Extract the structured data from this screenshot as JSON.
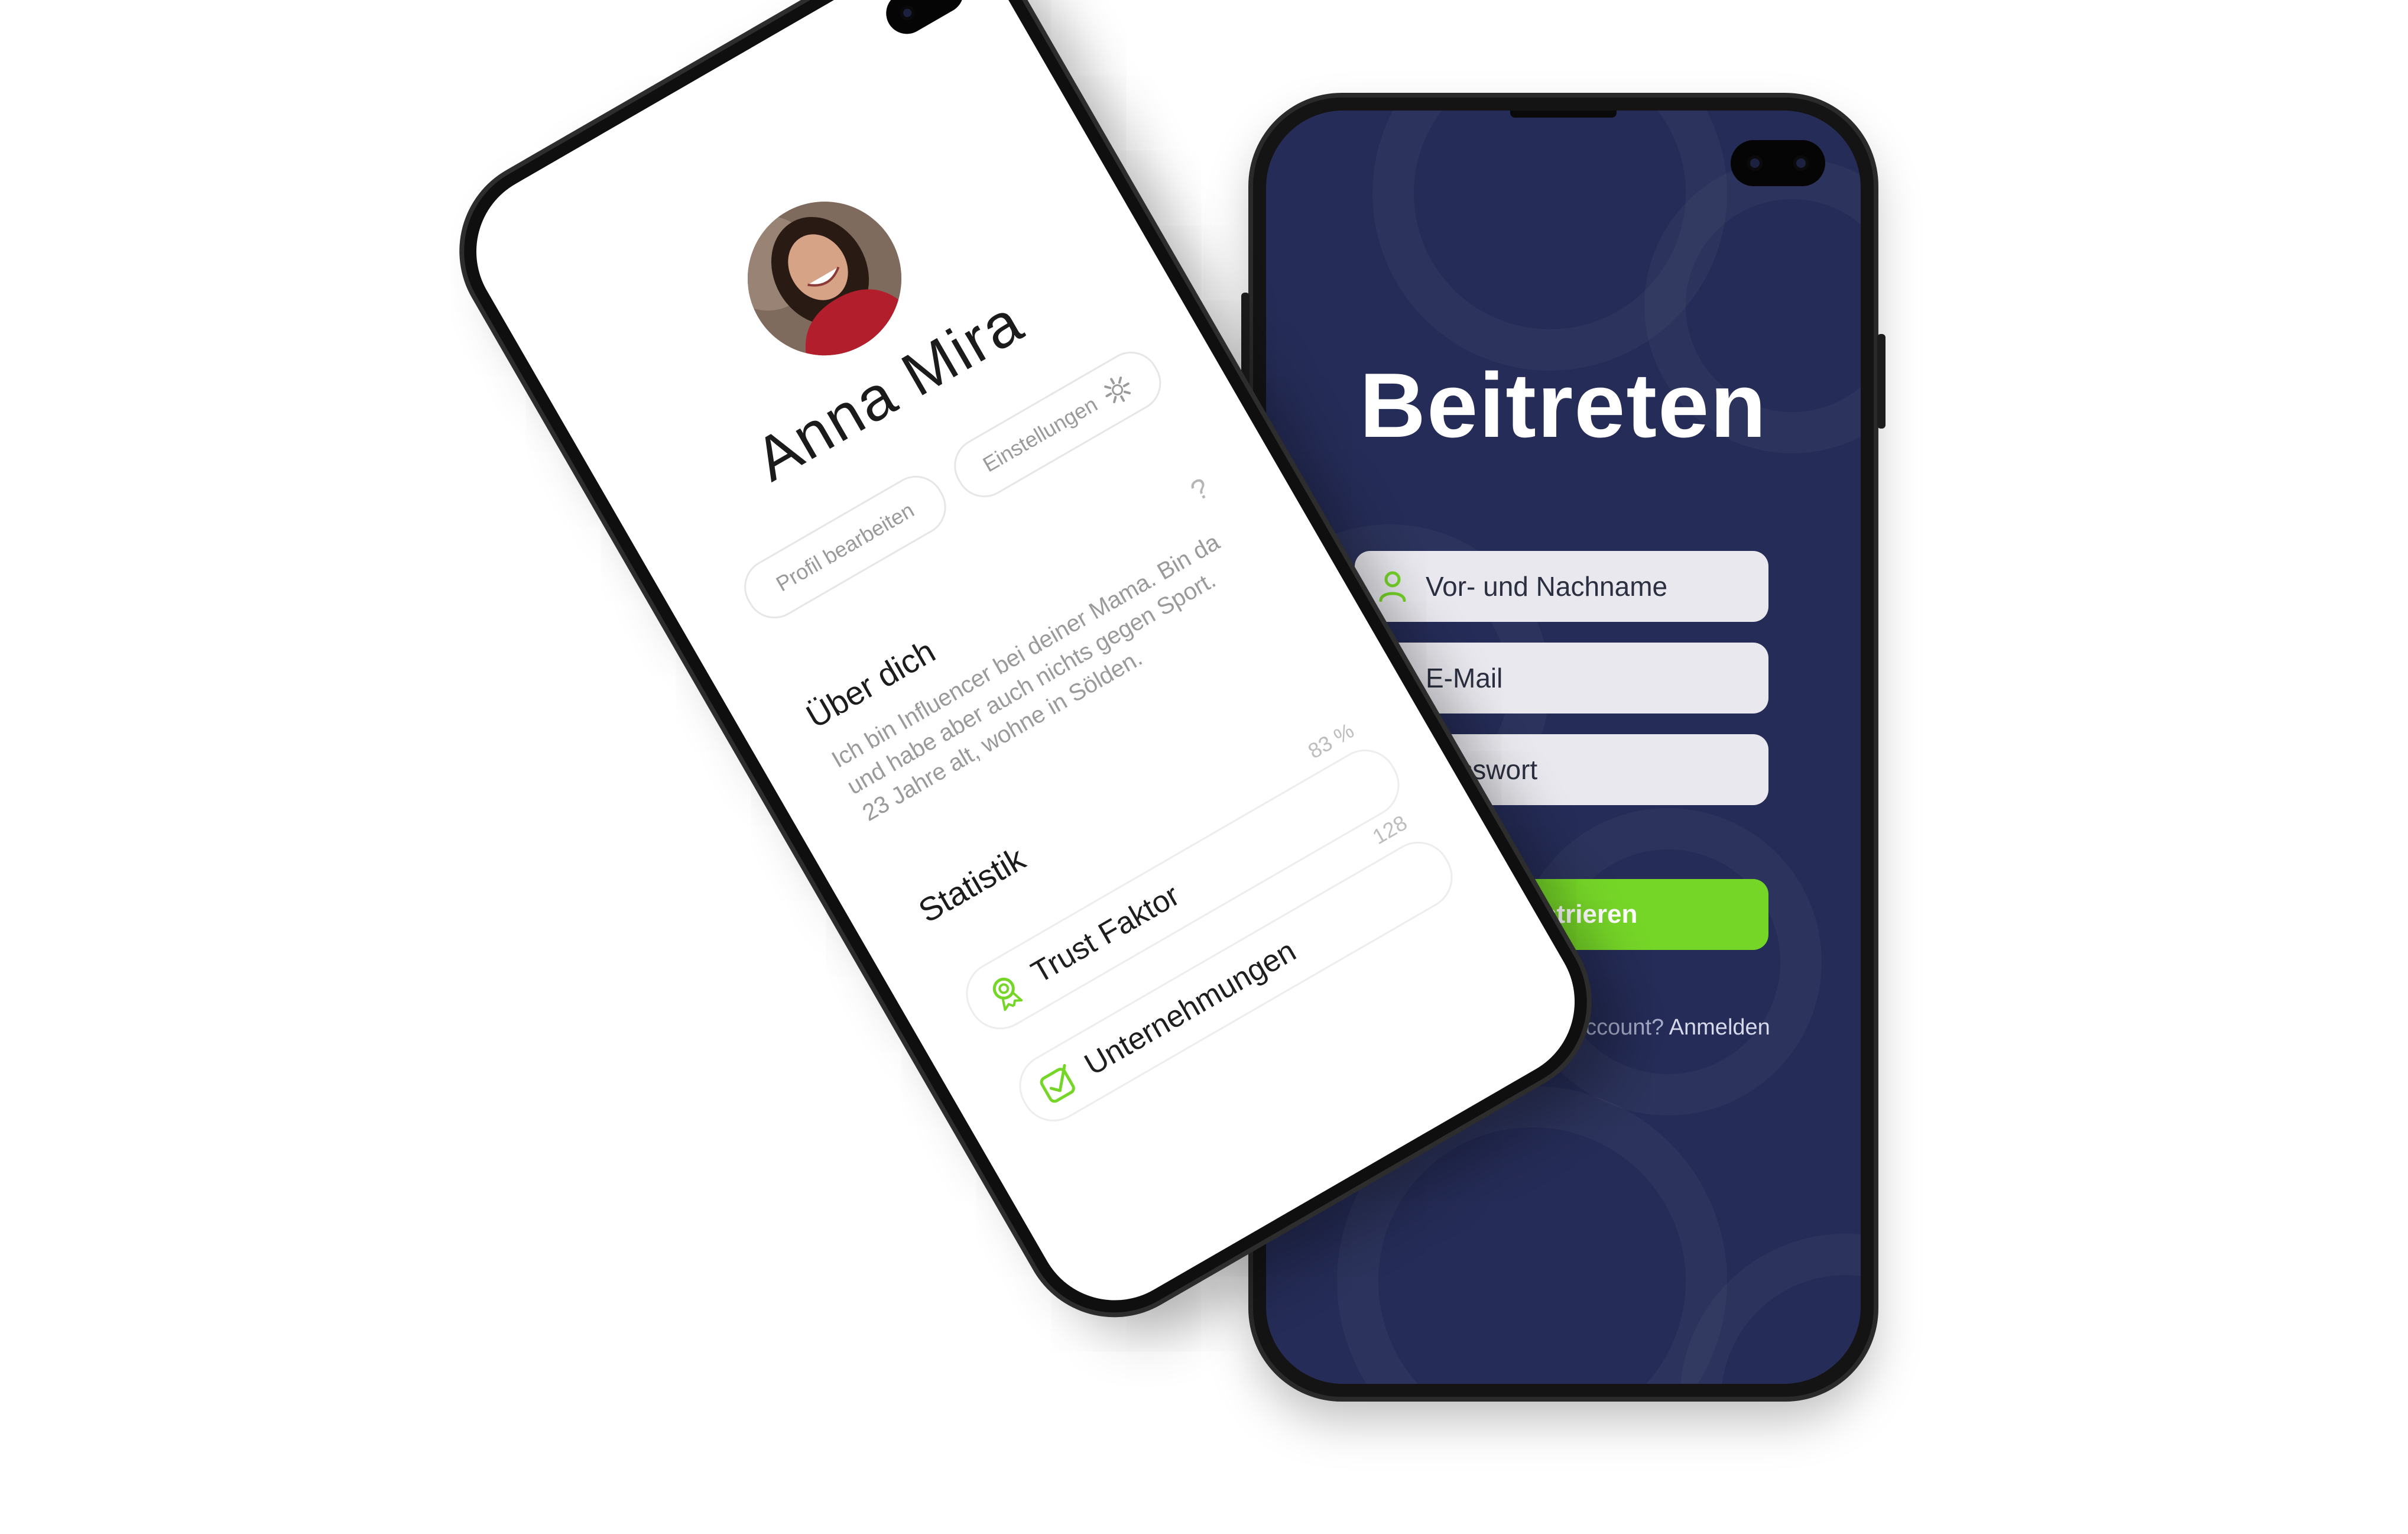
{
  "register_screen": {
    "title": "Beitreten",
    "fields": [
      {
        "placeholder": "Vor- und Nachname",
        "icon": "user-icon"
      },
      {
        "placeholder": "E-Mail",
        "icon": "mail-icon"
      },
      {
        "placeholder": "Passwort",
        "icon": "key-icon"
      }
    ],
    "submit_label": "Registrieren",
    "login_prompt": "Du hast bereits einen Account?",
    "login_link": "Anmelden"
  },
  "profile_screen": {
    "name": "Anna Mira",
    "edit_profile_label": "Profil bearbeiten",
    "settings_label": "Einstellungen",
    "about_title": "Über dich",
    "help_symbol": "?",
    "about_text": "Ich bin Influencer bei deiner Mama. Bin da und habe aber auch nichts gegen Sport. 23 Jahre alt, wohne in Sölden.",
    "stats_title": "Statistik",
    "stats": [
      {
        "label": "Trust Faktor",
        "value": "83 %",
        "icon": "award-icon"
      },
      {
        "label": "Unternehmungen",
        "value": "128",
        "icon": "checkbox-icon"
      }
    ]
  },
  "colors": {
    "accent_green": "#76d628",
    "navy_background": "#252c57",
    "field_background": "#e8e8ee"
  }
}
